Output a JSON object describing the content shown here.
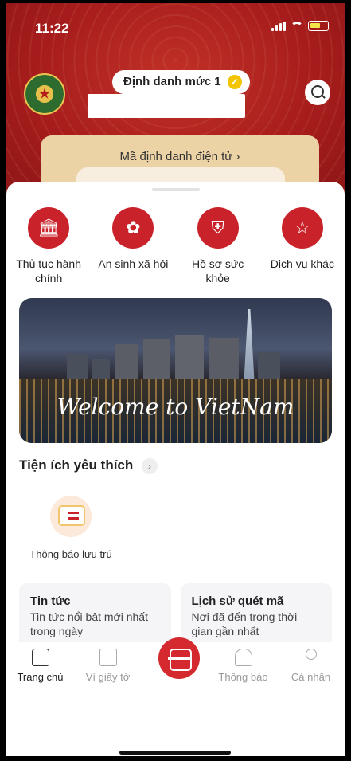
{
  "status_bar": {
    "time": "11:22"
  },
  "header": {
    "badge_label": "Định danh mức 1",
    "id_card_label": "Mã định danh điện tử  ›"
  },
  "services": [
    {
      "label": "Thủ tục hành chính",
      "icon": "government-building-icon"
    },
    {
      "label": "An sinh xã hội",
      "icon": "social-welfare-icon"
    },
    {
      "label": "Hồ sơ sức khỏe",
      "icon": "health-shield-icon"
    },
    {
      "label": "Dịch vụ khác",
      "icon": "other-services-icon"
    }
  ],
  "banner": {
    "text": "Welcome to VietNam"
  },
  "favorites": {
    "title": "Tiện ích yêu thích",
    "items": [
      {
        "label": "Thông báo lưu trú",
        "icon": "residence-notice-icon"
      }
    ]
  },
  "cards": [
    {
      "title": "Tin tức",
      "desc": "Tin tức nổi bật mới nhất trong ngày"
    },
    {
      "title": "Lịch sử quét mã",
      "desc": "Nơi đã đến trong thời gian gần nhất"
    }
  ],
  "tabbar": {
    "items": [
      {
        "label": "Trang chủ",
        "icon": "home-icon"
      },
      {
        "label": "Ví giấy tờ",
        "icon": "wallet-icon"
      },
      {
        "label": "",
        "icon": "qr-scan-icon"
      },
      {
        "label": "Thông báo",
        "icon": "bell-icon"
      },
      {
        "label": "Cá nhân",
        "icon": "user-icon"
      }
    ]
  },
  "colors": {
    "brand_red": "#c9222a",
    "header_red": "#a61c1c",
    "card_beige": "#ecd3a6",
    "badge_yellow": "#f2c500"
  }
}
